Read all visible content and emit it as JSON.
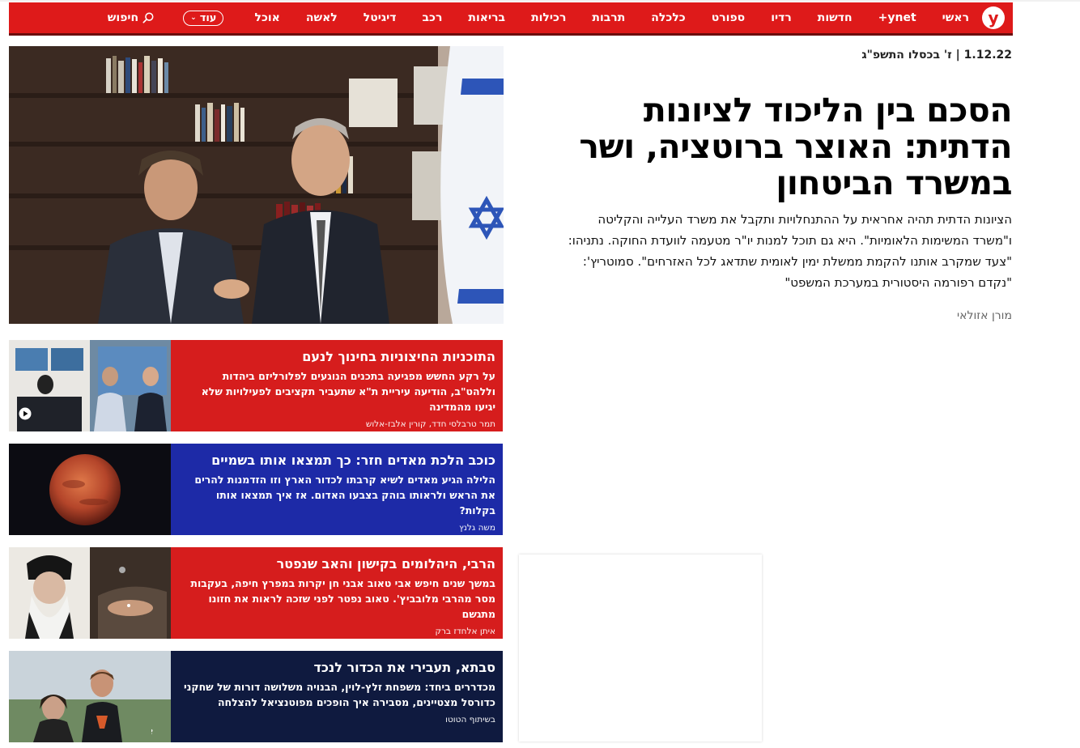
{
  "nav": {
    "logo": "y",
    "items": [
      "ראשי",
      "ynet+",
      "חדשות",
      "רדיו",
      "ספורט",
      "כלכלה",
      "תרבות",
      "רכילות",
      "בריאות",
      "רכב",
      "דיגיטל",
      "לאשה",
      "אוכל"
    ],
    "more_label": "עוד",
    "search_label": "חיפוש"
  },
  "main": {
    "date": "1.12.22  |  ז' בכסלו התשפ\"ג",
    "headline": "הסכם בין הליכוד לציונות הדתית: האוצר ברוטציה, ושר במשרד הביטחון",
    "lead": "הציונות הדתית תהיה אחראית על ההתנחלויות ותקבל את משרד העלייה והקליטה ו\"משרד המשימות הלאומיות\". היא גם תוכל למנות יו\"ר מטעמה לוועדת החוקה. נתניהו: \"צעד שמקרב אותנו להקמת ממשלת ימין לאומית שתדאג לכל האזרחים\". סמוטריץ': \"נקדם רפורמה היסטורית במערכת המשפט\"",
    "author": "מורן אזולאי"
  },
  "cards": [
    {
      "title": "התוכניות החיצוניות בחינוך לנעם",
      "sub": "על רקע החשש מפגיעה בתכנים הנוגעים לפלורליזם ביהדות וללהט\"ב, הודיעה עיריית ת\"א שתעביר תקציבים לפעילויות שלא יגיעו מהמדינה",
      "by": "תמר טרבלסי חדד, קורין אלבז-אלוש"
    },
    {
      "title": "כוכב הלכת מאדים חזר: כך תמצאו אותו בשמיים",
      "sub": "הלילה הגיע מאדים לשיא קרבתו לכדור הארץ וזו הזדמנות להרים את הראש ולראותו בוהק בצבעו האדום. אז איך תמצאו אותו בקלות?",
      "by": "משה גלנץ"
    },
    {
      "title": "הרבי, היהלומים בקישון והאב שנפטר",
      "sub": "במשך שנים חיפש אבי טאוב אבני חן יקרות במפרץ חיפה, בעקבות מסר מהרבי מלובביץ'. טאוב נפטר לפני שזכה לראות את חזונו מתגשם",
      "by": "איתן אלחדז ברק"
    },
    {
      "title": "סבתא, תעבירי את הכדור לנכד",
      "sub": "מכדררים ביחד: משפחת זלץ-לוין, הבנויה משלושה דורות של שחקני כדורסל מצטיינים, מסבירה איך הופכים מפוטנציאל להצלחה",
      "by": "בשיתוף הטוטו"
    }
  ],
  "colors": {
    "nav_red": "#de1a1a",
    "card_red": "#d61d1d",
    "card_blue": "#1d2aa7",
    "card_navy": "#0f1a3f"
  },
  "icons": {
    "search": "search-icon",
    "play": "play-icon",
    "sponsored": "sponsored-e-icon"
  }
}
